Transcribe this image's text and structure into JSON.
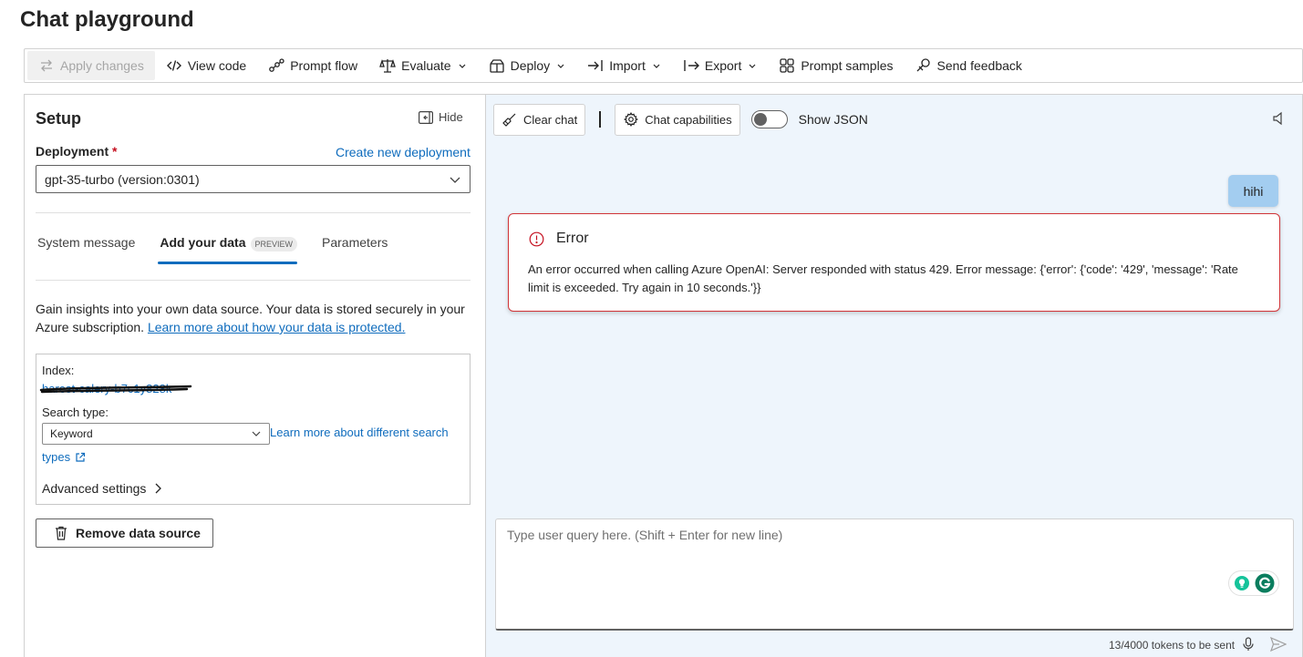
{
  "page": {
    "title": "Chat playground"
  },
  "toolbar": {
    "apply_changes": "Apply changes",
    "view_code": "View code",
    "prompt_flow": "Prompt flow",
    "evaluate": "Evaluate",
    "deploy": "Deploy",
    "import": "Import",
    "export": "Export",
    "prompt_samples": "Prompt samples",
    "send_feedback": "Send feedback"
  },
  "setup": {
    "title": "Setup",
    "hide_label": "Hide",
    "deployment_label": "Deployment",
    "required_marker": "*",
    "create_new_deployment": "Create new deployment",
    "deployment_value": "gpt-35-turbo (version:0301)",
    "tabs": [
      {
        "label": "System message"
      },
      {
        "label": "Add your data",
        "badge": "PREVIEW"
      },
      {
        "label": "Parameters"
      }
    ],
    "description": "Gain insights into your own data source. Your data is stored securely in your Azure subscription.",
    "description_link": "Learn more about how your data is protected.",
    "data_source": {
      "index_label": "Index:",
      "index_value": "harest-calery-b7c1y828k",
      "search_type_label": "Search type:",
      "search_type_value": "Keyword",
      "search_link_line1": "Learn more about different search",
      "search_link_line2": "types",
      "advanced_settings": "Advanced settings"
    },
    "remove_data_source": "Remove data source"
  },
  "chat": {
    "clear_chat": "Clear chat",
    "chat_capabilities": "Chat capabilities",
    "show_json": "Show JSON",
    "show_json_on": false,
    "user_message": "hihi",
    "error_title": "Error",
    "error_message": "An error occurred when calling Azure OpenAI: Server responded with status 429. Error message: {'error': {'code': '429', 'message': 'Rate limit is exceeded. Try again in 10 seconds.'}}",
    "input_placeholder": "Type user query here. (Shift + Enter for new line)",
    "tokens": "13/4000 tokens to be sent"
  },
  "colors": {
    "accent": "#0f6cbd",
    "error": "#d13438",
    "chat_bg": "#eef5fc",
    "user_bubble": "#a3cdf0",
    "grammarly": "#15c39a"
  },
  "icons": [
    "arrows-swap-icon",
    "code-icon",
    "flow-icon",
    "scale-icon",
    "box-icon",
    "import-icon",
    "export-icon",
    "grid-icon",
    "feedback-icon",
    "panel-hide-icon",
    "chevron-down-icon",
    "external-link-icon",
    "chevron-right-icon",
    "trash-icon",
    "broom-icon",
    "gear-icon",
    "speaker-icon",
    "error-circle-icon",
    "grammarly-icon",
    "mic-icon",
    "send-icon"
  ]
}
